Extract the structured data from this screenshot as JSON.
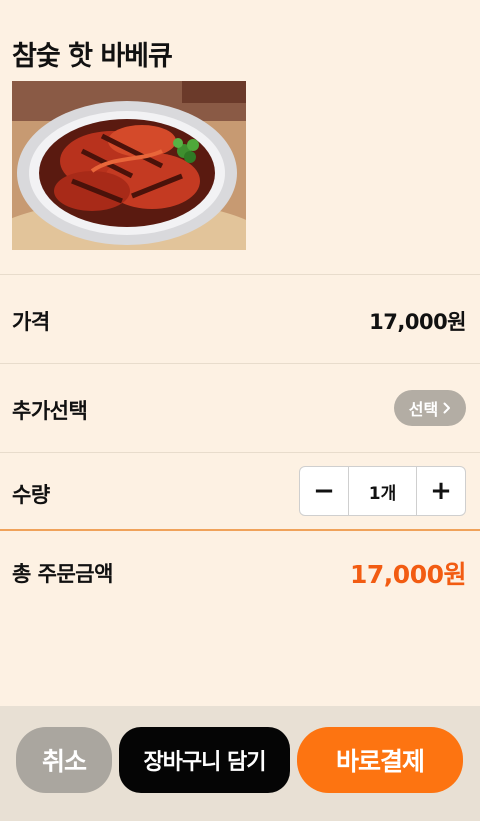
{
  "product": {
    "title": "참숯 핫 바베큐"
  },
  "price_row": {
    "label": "가격",
    "value": "17,000원"
  },
  "option_row": {
    "label": "추가선택",
    "button_label": "선택"
  },
  "quantity_row": {
    "label": "수량",
    "minus": "−",
    "plus": "+",
    "value": "1개"
  },
  "total_row": {
    "label": "총 주문금액",
    "value": "17,000원"
  },
  "actions": {
    "cancel": "취소",
    "add_to_cart": "장바구니 담기",
    "buy_now": "바로결제"
  },
  "colors": {
    "background": "#fdf1e3",
    "accent": "#fd7411",
    "total_price": "#f25c12",
    "option_button": "#b3ada4",
    "cart_button": "#050505",
    "cancel_button": "#aaa69f"
  }
}
